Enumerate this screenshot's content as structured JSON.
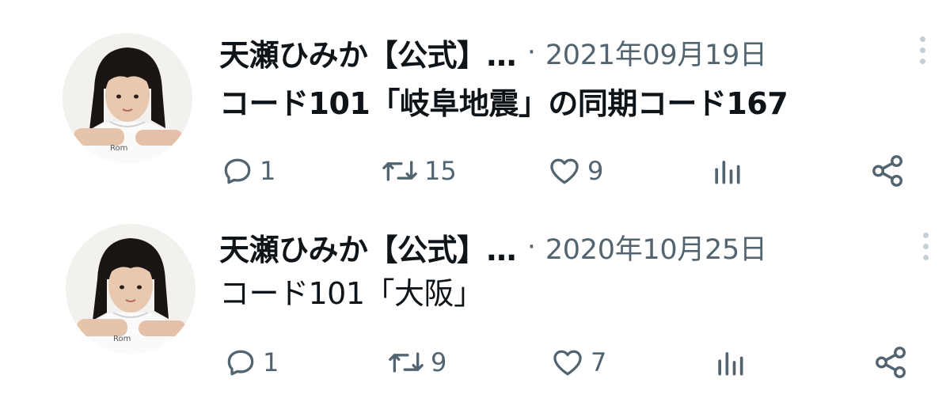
{
  "tweets": [
    {
      "display_name": "天瀬ひみか【公式】…",
      "separator": "·",
      "date": "2021年09月19日",
      "text": "コード101「岐阜地震」の同期コード167",
      "reply_count": "1",
      "retweet_count": "15",
      "like_count": "9"
    },
    {
      "display_name": "天瀬ひみか【公式】…",
      "separator": "·",
      "date": "2020年10月25日",
      "text": "コード101「大阪」",
      "reply_count": "1",
      "retweet_count": "9",
      "like_count": "7"
    }
  ],
  "icons": {
    "reply": "reply-icon",
    "retweet": "retweet-icon",
    "like": "heart-icon",
    "views": "analytics-icon",
    "share": "share-icon",
    "more": "more-vertical-icon"
  },
  "colors": {
    "text_primary": "#0f1419",
    "text_secondary": "#536471",
    "more_dots": "#c4cfd6",
    "background": "#ffffff"
  }
}
